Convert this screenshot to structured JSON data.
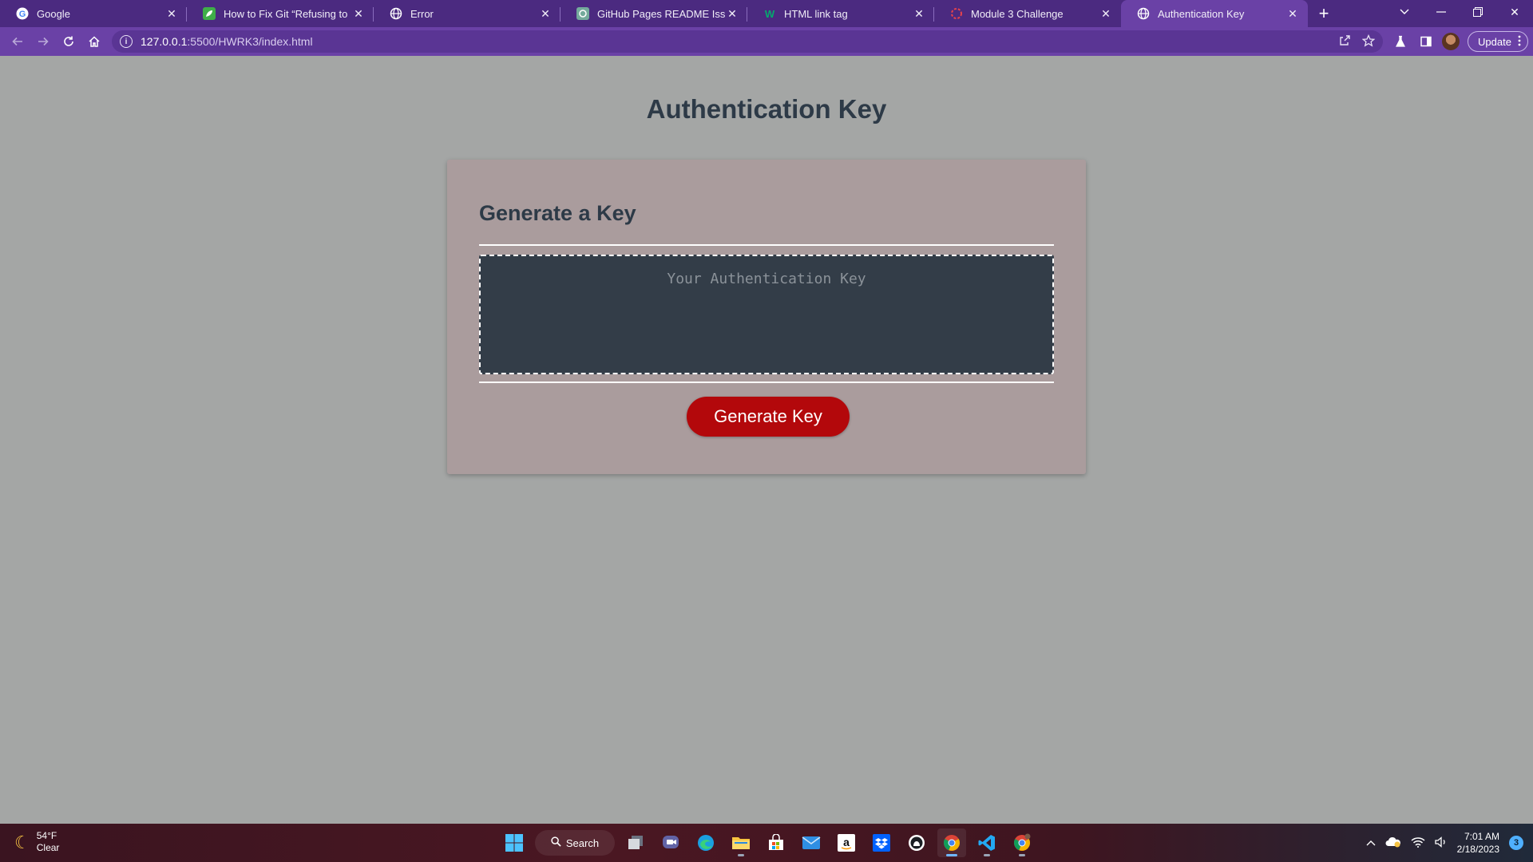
{
  "browser": {
    "tabs": [
      {
        "title": "Google",
        "icon": "google-icon",
        "active": false
      },
      {
        "title": "How to Fix Git “Refusing to Merge",
        "icon": "leaf-icon",
        "active": false
      },
      {
        "title": "Error",
        "icon": "globe-icon",
        "active": false
      },
      {
        "title": "GitHub Pages README Issue.",
        "icon": "openai-icon",
        "active": false
      },
      {
        "title": "HTML link tag",
        "icon": "w3schools-icon",
        "active": false
      },
      {
        "title": "Module 3 Challenge",
        "icon": "loading-ring-icon",
        "active": false
      },
      {
        "title": "Authentication Key",
        "icon": "globe-icon",
        "active": true
      }
    ],
    "address": {
      "host": "127.0.0.1",
      "path": ":5500/HWRK3/index.html"
    },
    "update_label": "Update"
  },
  "page": {
    "title": "Authentication Key",
    "card_header": "Generate a Key",
    "key_placeholder": "Your Authentication Key",
    "key_value": "",
    "button_label": "Generate Key",
    "colors": {
      "background": "#a4a6a5",
      "card": "#aa9c9d",
      "textarea": "#333d48",
      "button": "#b3080b",
      "heading": "#2d3a47"
    }
  },
  "taskbar": {
    "weather": {
      "temp": "54°F",
      "condition": "Clear"
    },
    "search_label": "Search",
    "clock": {
      "time": "7:01 AM",
      "date": "2/18/2023"
    },
    "notification_count": "3"
  }
}
